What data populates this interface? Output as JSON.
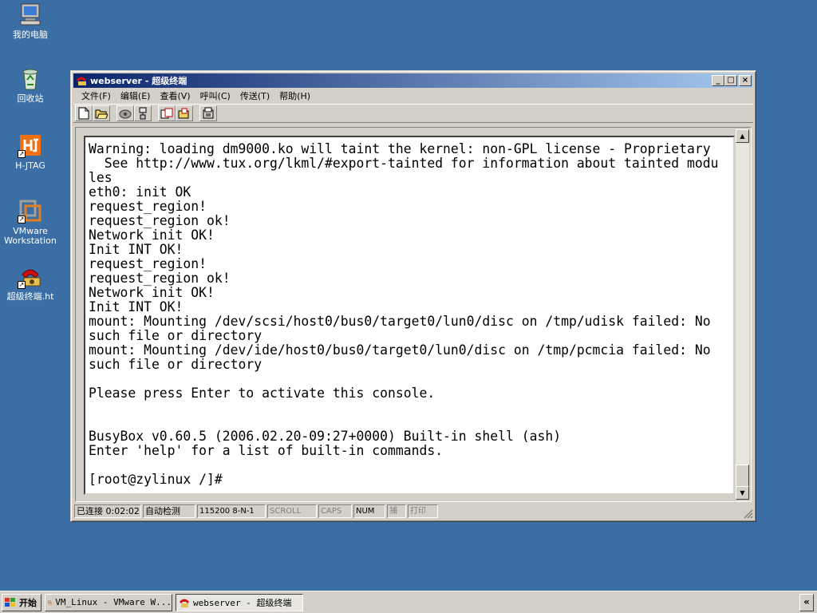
{
  "desktop": {
    "icons": [
      {
        "label": "我的电脑",
        "icon": "computer-icon"
      },
      {
        "label": "回收站",
        "icon": "recycle-bin-icon"
      },
      {
        "label": "H-JTAG",
        "icon": "hjtag-icon"
      },
      {
        "label": "VMware Workstation",
        "icon": "vmware-icon"
      },
      {
        "label": "超级终端.ht",
        "icon": "hyperterminal-icon"
      }
    ]
  },
  "window": {
    "title": "webserver - 超级终端",
    "buttons": {
      "minimize": "_",
      "maximize": "□",
      "close": "×"
    },
    "menu": [
      "文件(F)",
      "编辑(E)",
      "查看(V)",
      "呼叫(C)",
      "传送(T)",
      "帮助(H)"
    ],
    "toolbar": [
      "new-icon",
      "open-icon",
      "call-icon",
      "disconnect-icon",
      "send-icon",
      "receive-icon",
      "properties-icon"
    ],
    "terminal_lines": [
      "Warning: loading dm9000.ko will taint the kernel: non-GPL license - Proprietary",
      "  See http://www.tux.org/lkml/#export-tainted for information about tainted modu",
      "les",
      "eth0: init OK",
      "request_region!",
      "request_region ok!",
      "Network init OK!",
      "Init INT OK!",
      "request_region!",
      "request_region ok!",
      "Network init OK!",
      "Init INT OK!",
      "mount: Mounting /dev/scsi/host0/bus0/target0/lun0/disc on /tmp/udisk failed: No",
      "such file or directory",
      "mount: Mounting /dev/ide/host0/bus0/target0/lun0/disc on /tmp/pcmcia failed: No",
      "such file or directory",
      "",
      "Please press Enter to activate this console.",
      "",
      "",
      "BusyBox v0.60.5 (2006.02.20-09:27+0000) Built-in shell (ash)",
      "Enter 'help' for a list of built-in commands.",
      "",
      "[root@zylinux /]#"
    ],
    "status": {
      "connected": "已连接 0:02:02",
      "detect": "自动检测",
      "baud": "115200 8-N-1",
      "scroll": "SCROLL",
      "caps": "CAPS",
      "num": "NUM",
      "capture": "捕",
      "print": "打印"
    }
  },
  "taskbar": {
    "start": "开始",
    "tasks": [
      {
        "label": "VM_Linux - VMware W...",
        "active": false
      },
      {
        "label": "webserver - 超级终端",
        "active": true
      }
    ],
    "tray": "«"
  },
  "colors": {
    "desktop": "#3a6ea5",
    "titlebar_start": "#0a246a",
    "titlebar_end": "#a6caf0",
    "face": "#d4d0c8"
  }
}
